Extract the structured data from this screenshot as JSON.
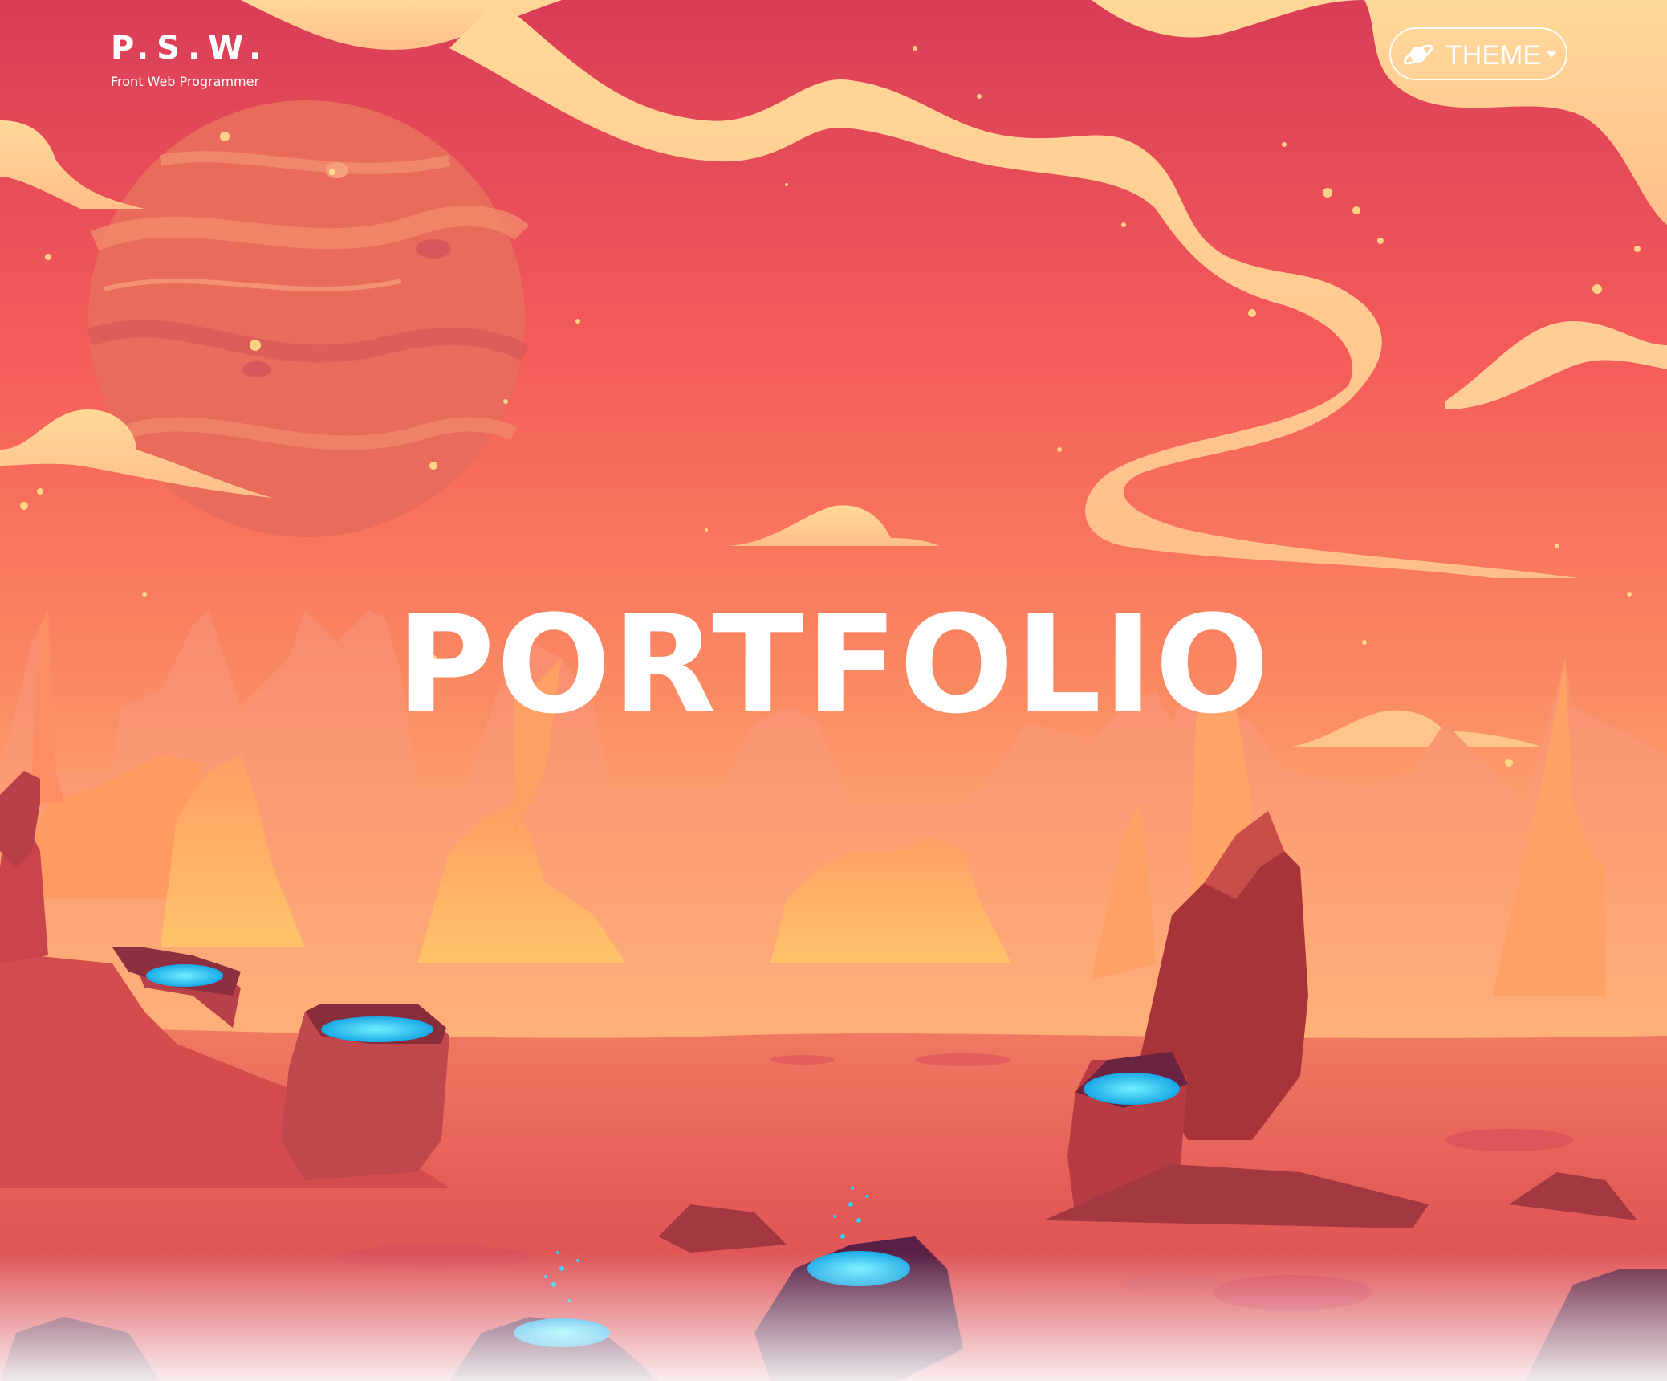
{
  "header": {
    "brand_name": "P.S.W.",
    "brand_tagline": "Front Web Programmer",
    "theme_button_label": "THEME",
    "theme_icon": "planet-icon",
    "dropdown_icon": "caret-down-icon"
  },
  "hero": {
    "title": "PORTFOLIO"
  },
  "colors": {
    "sky_top": "#d93d57",
    "sky_mid": "#f76a5c",
    "sky_horizon": "#ffd68a",
    "ground": "#e65a55",
    "crystal": "#2fd0f2",
    "text": "#ffffff"
  }
}
